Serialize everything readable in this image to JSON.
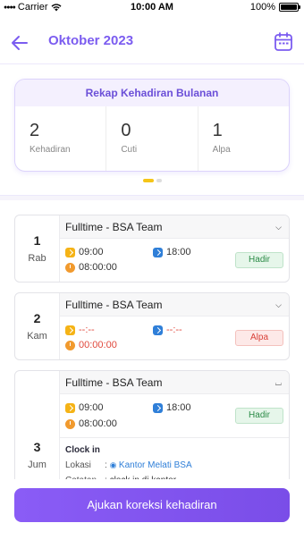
{
  "status_bar": {
    "carrier": "Carrier",
    "time": "10:00 AM",
    "battery": "100%",
    "battery_level": 1.0
  },
  "header": {
    "title": "Oktober 2023"
  },
  "recap": {
    "title": "Rekap Kehadiran Bulanan",
    "stats": [
      {
        "value": "2",
        "label": "Kehadiran"
      },
      {
        "value": "0",
        "label": "Cuti"
      },
      {
        "value": "1",
        "label": "Alpa"
      }
    ]
  },
  "days": [
    {
      "day_num": "1",
      "day_name": "Rab",
      "shift": "Fulltime - BSA Team",
      "clock_in": "09:00",
      "clock_out": "18:00",
      "duration": "08:00:00",
      "status": "Hadir"
    },
    {
      "day_num": "2",
      "day_name": "Kam",
      "shift": "Fulltime - BSA Team",
      "clock_in": "--:--",
      "clock_out": "--:--",
      "duration": "00:00:00",
      "status": "Alpa"
    },
    {
      "day_num": "3",
      "day_name": "Jum",
      "shift": "Fulltime - BSA Team",
      "clock_in": "09:00",
      "clock_out": "18:00",
      "duration": "08:00:00",
      "status": "Hadir",
      "detail": {
        "title": "Clock in",
        "location_label": "Lokasi",
        "location_value": "Kantor Melati BSA",
        "note_label": "Catatan",
        "note_value": "clock in di kantor"
      }
    }
  ],
  "footer": {
    "button_label": "Ajukan koreksi kehadiran"
  },
  "colors": {
    "accent": "#7b5cf0",
    "hadir": "#2a8a46",
    "alpa": "#d94038"
  }
}
